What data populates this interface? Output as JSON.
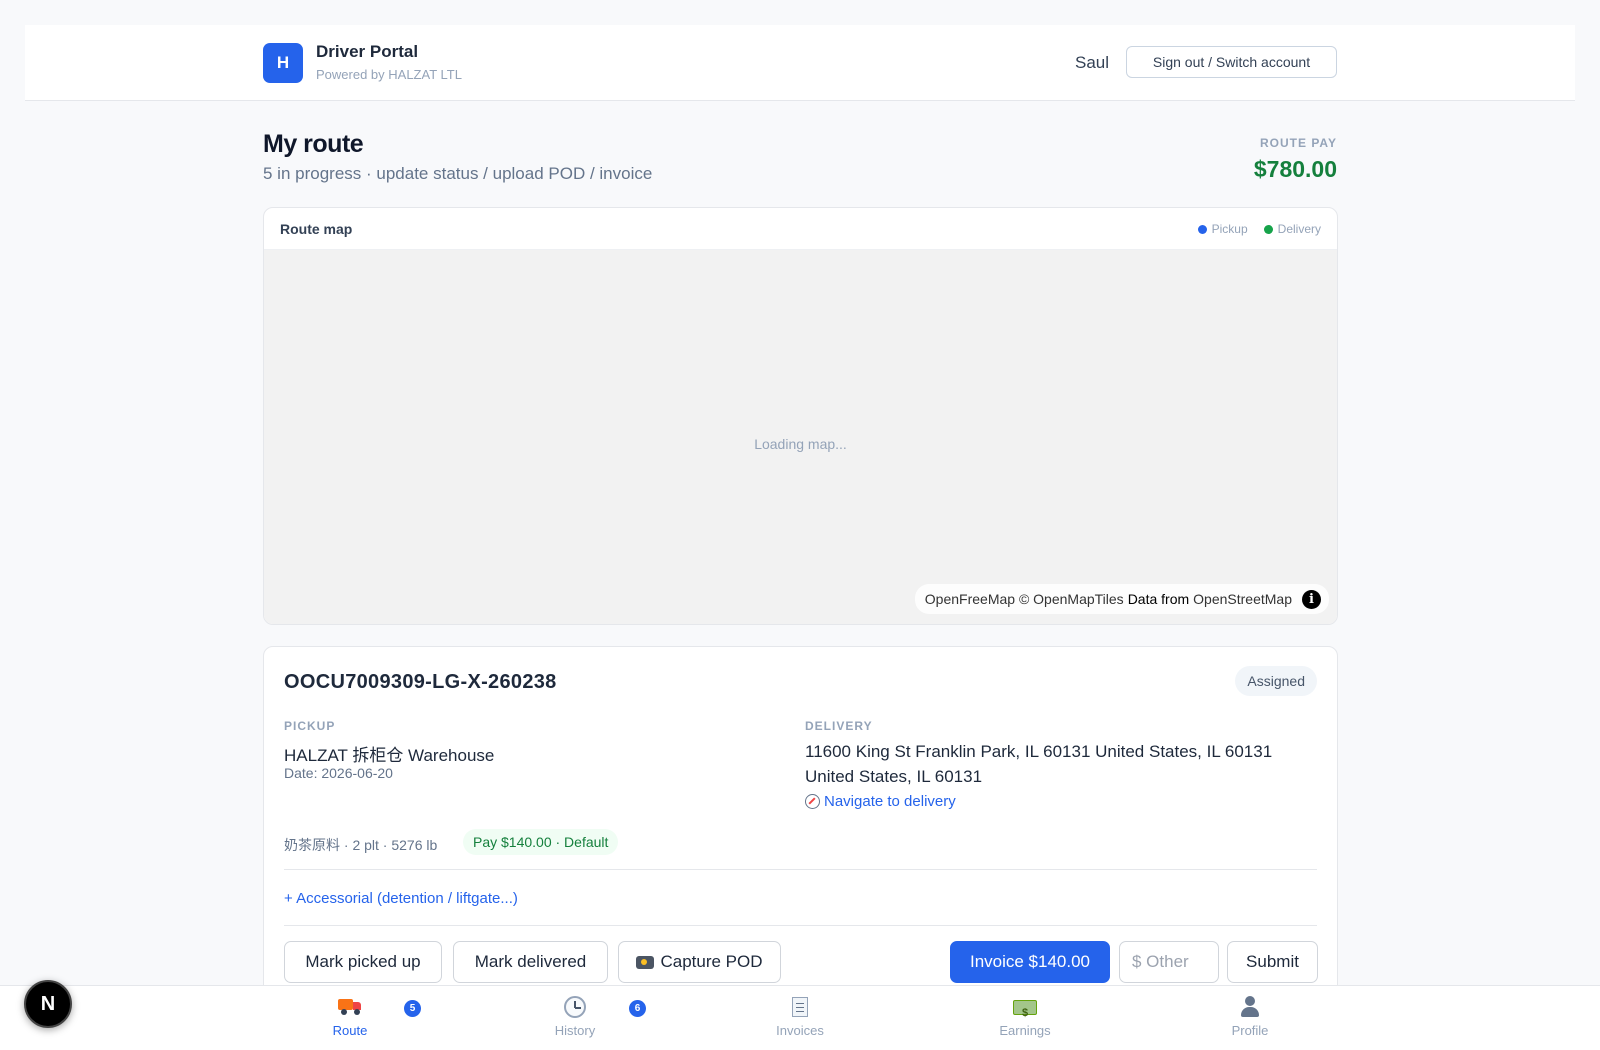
{
  "header": {
    "logo_letter": "H",
    "title": "Driver Portal",
    "subtitle": "Powered by HALZAT LTL",
    "user_name": "Saul",
    "signout_label": "Sign out / Switch account"
  },
  "page": {
    "title": "My route",
    "subtitle": "5 in progress · update status / upload POD / invoice",
    "route_pay_label": "ROUTE PAY",
    "route_pay_value": "$780.00"
  },
  "map": {
    "title": "Route map",
    "legend": [
      {
        "label": "Pickup",
        "color": "#2563eb"
      },
      {
        "label": "Delivery",
        "color": "#16a34a"
      }
    ],
    "loading_text": "Loading map...",
    "attribution": {
      "part1": "OpenFreeMap © OpenMapTiles",
      "part2": "Data from",
      "part3": "OpenStreetMap"
    }
  },
  "job": {
    "id": "OOCU7009309-LG-X-260238",
    "status": "Assigned",
    "pickup_label": "PICKUP",
    "pickup_name": "HALZAT 拆柜仓 Warehouse",
    "pickup_date": "Date: 2026-06-20",
    "delivery_label": "DELIVERY",
    "delivery_address": "11600 King St Franklin Park, IL 60131 United States, IL 60131 United States, IL 60131",
    "navigate_label": "Navigate to delivery",
    "cargo": "奶茶原料 · 2 plt · 5276 lb",
    "pay_badge": "Pay $140.00 · Default",
    "accessorial_label": "+ Accessorial (detention / liftgate...)",
    "actions": {
      "picked_up": "Mark picked up",
      "delivered": "Mark delivered",
      "capture_pod": "Capture POD",
      "invoice": "Invoice $140.00",
      "other_placeholder": "$ Other",
      "submit": "Submit"
    }
  },
  "bottom_nav": [
    {
      "label": "Route",
      "icon": "truck-icon",
      "count": "5",
      "active": true
    },
    {
      "label": "History",
      "icon": "clock-icon",
      "count": "6",
      "active": false
    },
    {
      "label": "Invoices",
      "icon": "receipt-icon",
      "active": false
    },
    {
      "label": "Earnings",
      "icon": "money-icon",
      "active": false
    },
    {
      "label": "Profile",
      "icon": "person-icon",
      "active": false
    }
  ],
  "dev_badge": "N",
  "colors": {
    "accent": "#2563eb",
    "pay_green": "#15803d",
    "pickup": "#2563eb",
    "delivery": "#16a34a"
  }
}
